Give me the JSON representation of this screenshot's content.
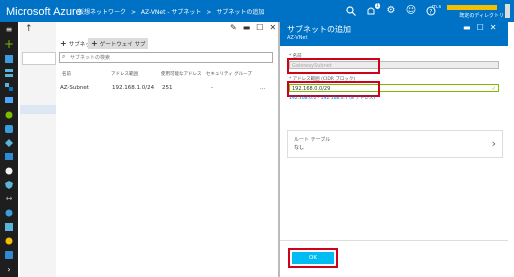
{
  "header": {
    "brand": "Microsoft Azure",
    "breadcrumb": [
      "仮想ネットワーク",
      ">",
      "AZ-VNet - サブネット",
      ">",
      "サブネットの追加"
    ],
    "notification_count": "1",
    "user_name": "m.s",
    "user_directory": "既定のディレクトリ"
  },
  "subnets_blade": {
    "toolbar": {
      "add_subnet": "サブネット",
      "add_gateway_subnet": "ゲートウェイ サブ"
    },
    "search_placeholder": "サブネットの検索",
    "columns": [
      "名前",
      "アドレス範囲",
      "使用可能なアドレス",
      "セキュリティ グループ"
    ],
    "rows": [
      {
        "name": "AZ-Subnet",
        "address_range": "192.168.1.0/24",
        "available": "251",
        "security_group": "-",
        "more": "..."
      }
    ]
  },
  "add_subnet_blade": {
    "title": "サブネットの追加",
    "subtitle": "AZ-VNet",
    "name_label": "* 名前",
    "name_value": "GatewaySubnet",
    "cidr_label": "* アドレス範囲 (CIDR ブロック)",
    "cidr_value": "192.168.0.0/29",
    "cidr_hint": "192.168.0.0 - 192.168.0.7 (8 アドレス)",
    "route_table_label": "ルート テーブル",
    "route_table_value": "なし",
    "ok_label": "OK"
  },
  "colors": {
    "azure_blue": "#0072c6",
    "sidebar": "#1e1e1e",
    "ok_button": "#00bcf2",
    "highlight_red": "#d0021b",
    "user_bar": "#f2c000"
  }
}
